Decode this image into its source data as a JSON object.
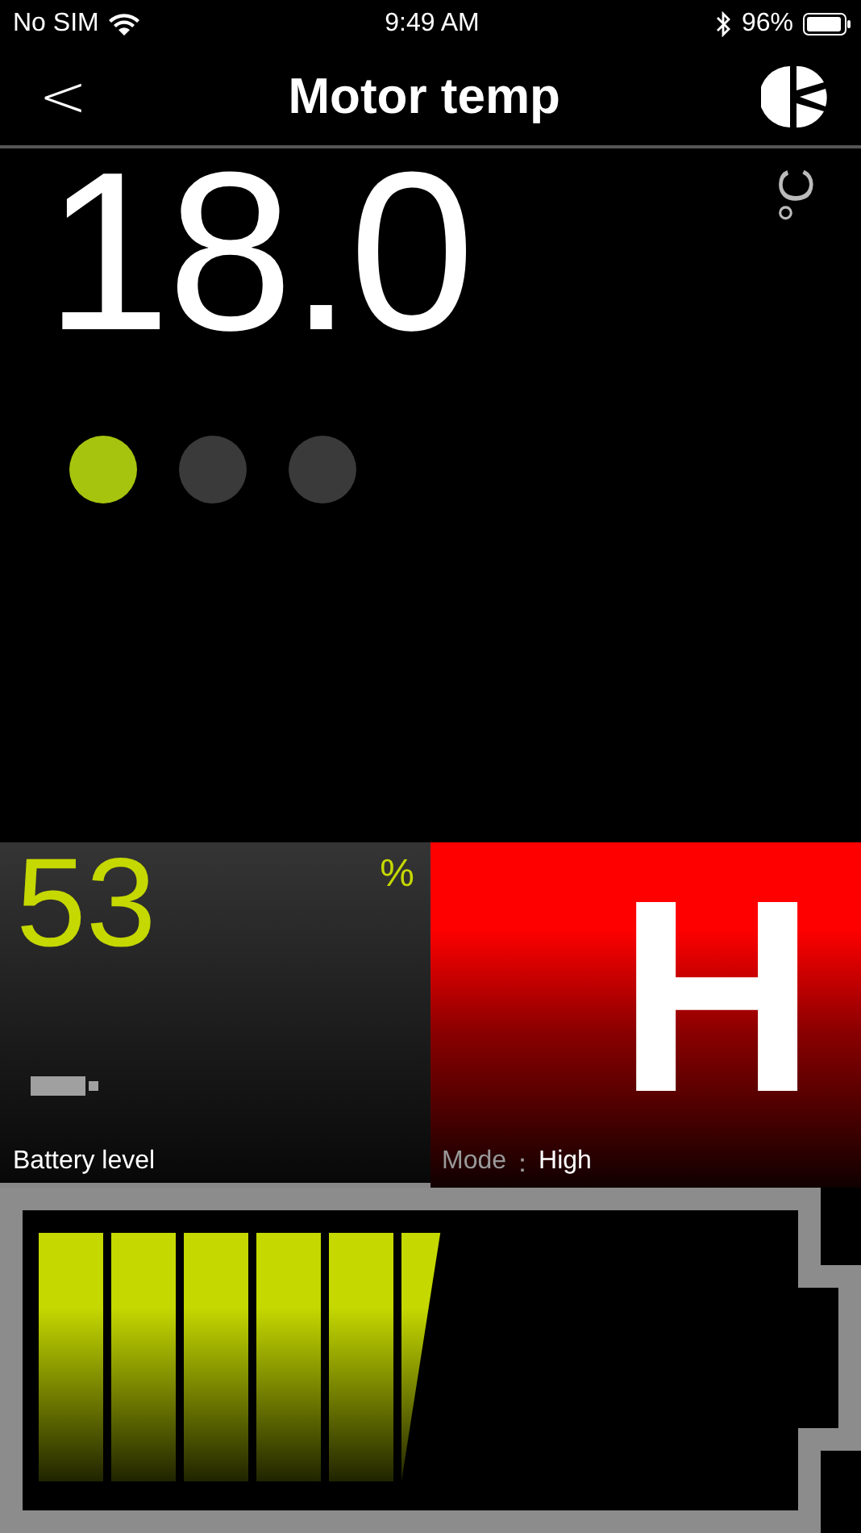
{
  "status_bar": {
    "carrier": "No SIM",
    "time": "9:49 AM",
    "battery": "96%"
  },
  "nav": {
    "back": "<",
    "title": "Motor temp"
  },
  "reading": {
    "value": "18.0",
    "unit": "°C"
  },
  "indicators": [
    {
      "on": true
    },
    {
      "on": false
    },
    {
      "on": false
    }
  ],
  "tiles": [
    {
      "kind": "battery",
      "value": "53",
      "unit": "%",
      "label": "Battery level"
    },
    {
      "kind": "mode",
      "value": "H",
      "label": "Mode",
      "separator": "：",
      "mode": "High"
    }
  ],
  "battery_gauge": {
    "level": 0.53
  }
}
